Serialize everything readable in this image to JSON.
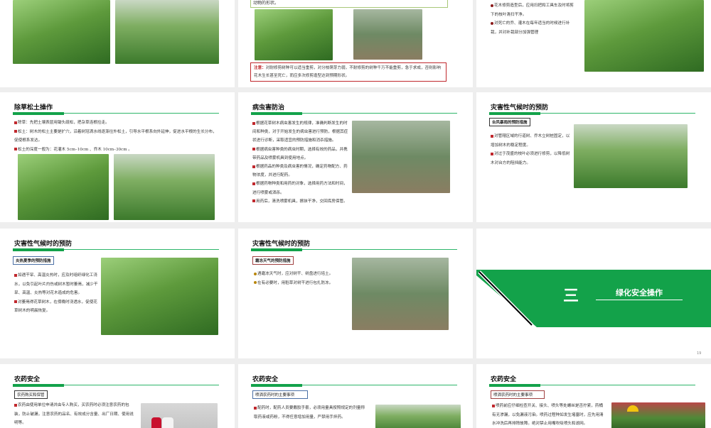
{
  "colors": {
    "accent": "#13a24a",
    "bullet_red": "#c0282d",
    "bullet_brown": "#b8860b",
    "bg": "#eeeeee"
  },
  "row1": {
    "s2": {
      "top_text": "动物的形状。",
      "note_label": "注意：",
      "note_text": "对耐修剪树种可以适当重剪，对分枝萌芽力弱，不耐修剪的树种千万不能重剪，急于求成，否则影响花木生长甚至死亡，而应多次修剪造型达到预期形状。"
    },
    "s3": {
      "bullets": [
        "花木修剪造型后，应用扫把和工具车及时将剪下的枝叶清扫干净。",
        "对死亡的乔、灌木在每年适当的时候进行补栽，并对补栽部分加强管理"
      ]
    }
  },
  "row2": {
    "s1": {
      "title": "除草松土操作",
      "bullets": [
        "除草：先把土壤表层用锄头疏松，把杂草连根捡走。",
        "松土：树木的松土主要是扩穴，沿着树冠滴水线逐渐往外松土，引导水平根系向外延伸，促进水平根的生长分布，促使根系发达。",
        "松土的深度一般为：花灌木 5cm–10cm 、乔木 10cm–30cm 。"
      ]
    },
    "s2": {
      "title": "病虫害防治",
      "bullets": [
        "根据花草树木病虫害发生的规律，准确判断发生的时间和种类，对于开始发生的病虫害进行预防，根据其症状进行诊断，采取适宜的预防措施和消杀措施。",
        "根据病虫害种类的病虫时期，选择有效的药品，并携带药品及喷雾机具到使用地点。",
        "根据药品的种类及病虫害的情况，确定药物配方、药物浓度，并进行配药。",
        "根据药物种类和用药的对象，选择用药方法和时间，进行喷雾或洒杀。",
        "用药后，清洗喷雾机具，擦抹干净，交回库房保管。"
      ]
    },
    "s3": {
      "title": "灾害性气候时的预防",
      "subtitle": "台风暴雨的预防措施",
      "bullets": [
        "对管辖区域的行道树、乔木立树桩固定，以增加树木的稳定程度。",
        "对过于茂盛的枝叶必须进行修剪，以降低树木对台方的阻挡能力。"
      ]
    }
  },
  "row3": {
    "s1": {
      "title": "灾害性气候时的预防",
      "subtitle": "炎热夏季的预防措施",
      "bullets": [
        "如遇干旱、高温炎热时，应及时组织绿化工浇水，以免引起叶片灼伤或树木暂时萎焉，减少干旱、高温、炎热等对花木造成的危害。",
        "对萎焉得花草树木，在傍晚时浇透水，促使花草树木的明晨恢复。"
      ]
    },
    "s2": {
      "title": "灾害性气候时的预防",
      "subtitle": "霜冻天气的预防措施",
      "bullets": [
        "遇霜冻天气时，应对树干、树盘进行培土。",
        "在有必要时，用稻草对树干进行包扎防冻。"
      ]
    },
    "s3": {
      "numeral": "三",
      "section_title": "绿化安全操作",
      "page_number": "19"
    }
  },
  "row4": {
    "s1": {
      "title": "农药安全",
      "subtitle": "农药购买和保管",
      "bullets": [
        "农药由使用单位申请并由专人购买，买农药时必须注意农药的包装，防止破漏，注意农药的品名、有效成分含量、出厂日期、使用说明等。"
      ]
    },
    "s2": {
      "title": "农药安全",
      "subtitle": "喷洒农药时的主要事项",
      "bullets": [
        "配药时，配药人员要戴胶手套，必须用量具按照规定的剂量称取药液或药粉，不得任意增加用量，严禁用手拌药。"
      ]
    },
    "s3": {
      "title": "农药安全",
      "subtitle": "喷洒农药时的主要事项",
      "bullets": [
        "喷药前应仔细检查开关、接头、喷头等处螺丝是否拧紧，药桶有无渗漏，以免漏液污染。喷药过程种如发生堵塞时，应先用清水冲洗后再排除故障。绝对禁止用嘴吹吸喷头和滤网。"
      ]
    }
  }
}
